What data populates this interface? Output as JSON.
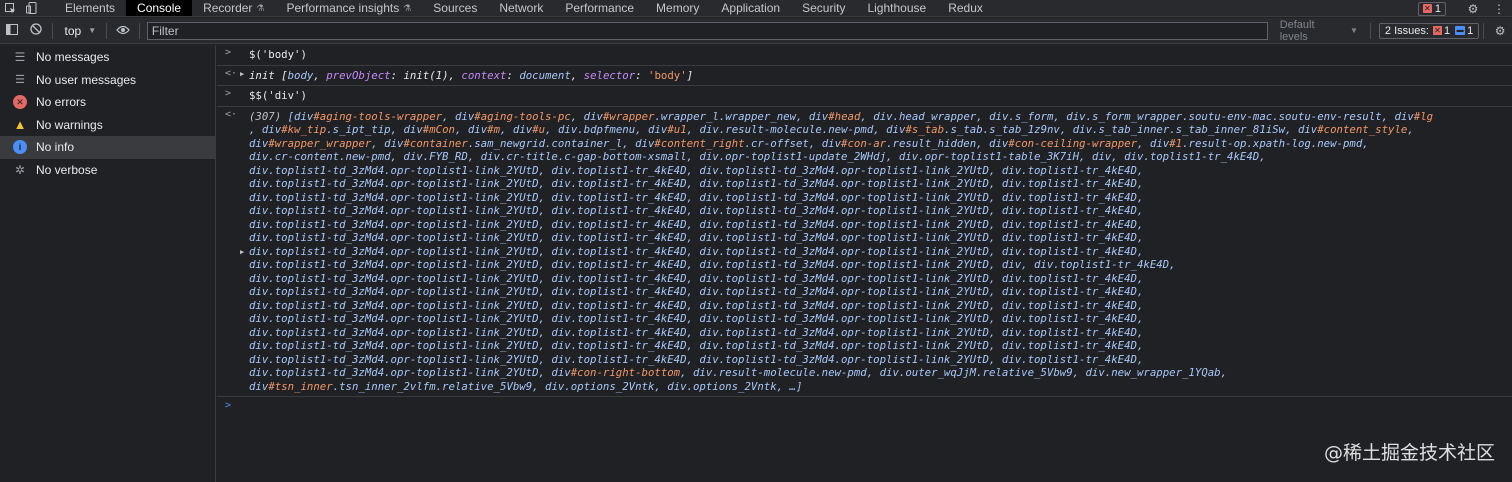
{
  "tabs": [
    {
      "label": "Elements",
      "active": false
    },
    {
      "label": "Console",
      "active": true
    },
    {
      "label": "Recorder",
      "active": false,
      "experimental": true
    },
    {
      "label": "Performance insights",
      "active": false,
      "experimental": true
    },
    {
      "label": "Sources",
      "active": false
    },
    {
      "label": "Network",
      "active": false
    },
    {
      "label": "Performance",
      "active": false
    },
    {
      "label": "Memory",
      "active": false
    },
    {
      "label": "Application",
      "active": false
    },
    {
      "label": "Security",
      "active": false
    },
    {
      "label": "Lighthouse",
      "active": false
    },
    {
      "label": "Redux",
      "active": false
    }
  ],
  "topbar": {
    "error_count": "1"
  },
  "toolbar": {
    "context": "top",
    "filter_placeholder": "Filter",
    "levels": "Default levels",
    "issues_label": "2 Issues:",
    "issues_errors": "1",
    "issues_info": "1"
  },
  "sidebar": {
    "items": [
      {
        "label": "No messages",
        "icon": "list-icon"
      },
      {
        "label": "No user messages",
        "icon": "user-icon"
      },
      {
        "label": "No errors",
        "icon": "error-icon"
      },
      {
        "label": "No warnings",
        "icon": "warning-icon"
      },
      {
        "label": "No info",
        "icon": "info-icon",
        "active": true
      },
      {
        "label": "No verbose",
        "icon": "bug-icon"
      }
    ]
  },
  "console": {
    "cmd1": "$('body')",
    "out1": {
      "prefix": "init [",
      "body": "body",
      "po_key": "prevObject",
      "po_val": "init(1)",
      "ctx_key": "context",
      "ctx_val": "document",
      "sel_key": "selector",
      "sel_val": "'body'",
      "suffix": "]"
    },
    "cmd2": "$$('div')",
    "out2_count": "(307)",
    "out2_lines": [
      "[div#aging-tools-wrapper, div#aging-tools-pc, div#wrapper.wrapper_l.wrapper_new, div#head, div.head_wrapper, div.s_form, div.s_form_wrapper.soutu-env-mac.soutu-env-result, div#lg",
      ", div#kw_tip.s_ipt_tip, div#mCon, div#m, div#u, div.bdpfmenu, div#u1, div.result-molecule.new-pmd, div#s_tab.s_tab.s_tab_1z9nv, div.s_tab_inner.s_tab_inner_81iSw, div#content_style,",
      "div#wrapper_wrapper, div#container.sam_newgrid.container_l, div#content_right.cr-offset, div#con-ar.result_hidden, div#con-ceiling-wrapper, div#1.result-op.xpath-log.new-pmd,",
      "div.cr-content.new-pmd, div.FYB_RD, div.cr-title.c-gap-bottom-xsmall, div.opr-toplist1-update_2WHdj, div.opr-toplist1-table_3K7iH, div, div.toplist1-tr_4kE4D,",
      "div.toplist1-td_3zMd4.opr-toplist1-link_2YUtD, div.toplist1-tr_4kE4D, div.toplist1-td_3zMd4.opr-toplist1-link_2YUtD, div.toplist1-tr_4kE4D,",
      "div.toplist1-td_3zMd4.opr-toplist1-link_2YUtD, div.toplist1-tr_4kE4D, div.toplist1-td_3zMd4.opr-toplist1-link_2YUtD, div.toplist1-tr_4kE4D,",
      "div.toplist1-td_3zMd4.opr-toplist1-link_2YUtD, div.toplist1-tr_4kE4D, div.toplist1-td_3zMd4.opr-toplist1-link_2YUtD, div.toplist1-tr_4kE4D,",
      "div.toplist1-td_3zMd4.opr-toplist1-link_2YUtD, div.toplist1-tr_4kE4D, div.toplist1-td_3zMd4.opr-toplist1-link_2YUtD, div.toplist1-tr_4kE4D,",
      "div.toplist1-td_3zMd4.opr-toplist1-link_2YUtD, div.toplist1-tr_4kE4D, div.toplist1-td_3zMd4.opr-toplist1-link_2YUtD, div.toplist1-tr_4kE4D,",
      "div.toplist1-td_3zMd4.opr-toplist1-link_2YUtD, div.toplist1-tr_4kE4D, div.toplist1-td_3zMd4.opr-toplist1-link_2YUtD, div.toplist1-tr_4kE4D,",
      "div.toplist1-td_3zMd4.opr-toplist1-link_2YUtD, div.toplist1-tr_4kE4D, div.toplist1-td_3zMd4.opr-toplist1-link_2YUtD, div.toplist1-tr_4kE4D,",
      "div.toplist1-td_3zMd4.opr-toplist1-link_2YUtD, div.toplist1-tr_4kE4D, div.toplist1-td_3zMd4.opr-toplist1-link_2YUtD, div, div.toplist1-tr_4kE4D,",
      "div.toplist1-td_3zMd4.opr-toplist1-link_2YUtD, div.toplist1-tr_4kE4D, div.toplist1-td_3zMd4.opr-toplist1-link_2YUtD, div.toplist1-tr_4kE4D,",
      "div.toplist1-td_3zMd4.opr-toplist1-link_2YUtD, div.toplist1-tr_4kE4D, div.toplist1-td_3zMd4.opr-toplist1-link_2YUtD, div.toplist1-tr_4kE4D,",
      "div.toplist1-td_3zMd4.opr-toplist1-link_2YUtD, div.toplist1-tr_4kE4D, div.toplist1-td_3zMd4.opr-toplist1-link_2YUtD, div.toplist1-tr_4kE4D,",
      "div.toplist1-td_3zMd4.opr-toplist1-link_2YUtD, div.toplist1-tr_4kE4D, div.toplist1-td_3zMd4.opr-toplist1-link_2YUtD, div.toplist1-tr_4kE4D,",
      "div.toplist1-td_3zMd4.opr-toplist1-link_2YUtD, div.toplist1-tr_4kE4D, div.toplist1-td_3zMd4.opr-toplist1-link_2YUtD, div.toplist1-tr_4kE4D,",
      "div.toplist1-td_3zMd4.opr-toplist1-link_2YUtD, div.toplist1-tr_4kE4D, div.toplist1-td_3zMd4.opr-toplist1-link_2YUtD, div.toplist1-tr_4kE4D,",
      "div.toplist1-td_3zMd4.opr-toplist1-link_2YUtD, div.toplist1-tr_4kE4D, div.toplist1-td_3zMd4.opr-toplist1-link_2YUtD, div.toplist1-tr_4kE4D,",
      "div.toplist1-td_3zMd4.opr-toplist1-link_2YUtD, div#con-right-bottom, div.result-molecule.new-pmd, div.outer_wqJjM.relative_5Vbw9, div.new_wrapper_1YQab,",
      "div#tsn_inner.tsn_inner_2vlfm.relative_5Vbw9, div.options_2Vntk, div.options_2Vntk, …]"
    ]
  },
  "watermark": "@稀土掘金技术社区"
}
